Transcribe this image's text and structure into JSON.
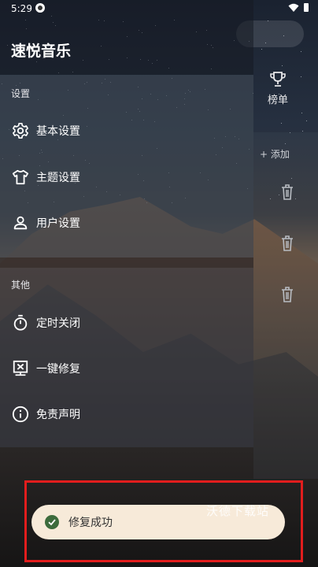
{
  "status_bar": {
    "time": "5:29"
  },
  "drawer": {
    "title": "速悦音乐",
    "settings_header": "设置",
    "settings_items": [
      {
        "label": "基本设置",
        "icon": "gear-icon"
      },
      {
        "label": "主题设置",
        "icon": "shirt-icon"
      },
      {
        "label": "用户设置",
        "icon": "person-icon"
      }
    ],
    "other_header": "其他",
    "other_items": [
      {
        "label": "定时关闭",
        "icon": "timer-icon"
      },
      {
        "label": "一键修复",
        "icon": "repair-icon"
      },
      {
        "label": "免责声明",
        "icon": "info-icon"
      }
    ]
  },
  "main": {
    "rank_label": "榜单",
    "add_label": "+ 添加"
  },
  "toast": {
    "text": "修复成功"
  },
  "watermark": "沃德下载站",
  "colors": {
    "toast_bg": "#f7ead9",
    "toast_icon": "#3d6b3c",
    "highlight": "#e21d1d"
  }
}
